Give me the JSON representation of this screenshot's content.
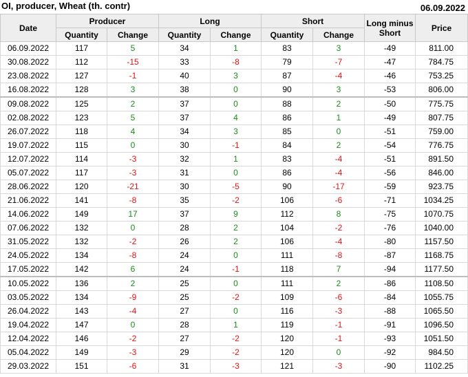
{
  "header": {
    "title": "OI, producer, Wheat (th. contr)",
    "date": "06.09.2022"
  },
  "columns": {
    "date": "Date",
    "producer": "Producer",
    "long": "Long",
    "short": "Short",
    "long_minus_short": "Long minus Short",
    "price": "Price",
    "quantity": "Quantity",
    "change": "Change"
  },
  "rows": [
    [
      "06.09.2022",
      "117",
      "5",
      "34",
      "1",
      "83",
      "3",
      "-49",
      "811.00"
    ],
    [
      "30.08.2022",
      "112",
      "-15",
      "33",
      "-8",
      "79",
      "-7",
      "-47",
      "784.75"
    ],
    [
      "23.08.2022",
      "127",
      "-1",
      "40",
      "3",
      "87",
      "-4",
      "-46",
      "753.25"
    ],
    [
      "16.08.2022",
      "128",
      "3",
      "38",
      "0",
      "90",
      "3",
      "-53",
      "806.00"
    ],
    [
      "09.08.2022",
      "125",
      "2",
      "37",
      "0",
      "88",
      "2",
      "-50",
      "775.75"
    ],
    [
      "02.08.2022",
      "123",
      "5",
      "37",
      "4",
      "86",
      "1",
      "-49",
      "807.75"
    ],
    [
      "26.07.2022",
      "118",
      "4",
      "34",
      "3",
      "85",
      "0",
      "-51",
      "759.00"
    ],
    [
      "19.07.2022",
      "115",
      "0",
      "30",
      "-1",
      "84",
      "2",
      "-54",
      "776.75"
    ],
    [
      "12.07.2022",
      "114",
      "-3",
      "32",
      "1",
      "83",
      "-4",
      "-51",
      "891.50"
    ],
    [
      "05.07.2022",
      "117",
      "-3",
      "31",
      "0",
      "86",
      "-4",
      "-56",
      "846.00"
    ],
    [
      "28.06.2022",
      "120",
      "-21",
      "30",
      "-5",
      "90",
      "-17",
      "-59",
      "923.75"
    ],
    [
      "21.06.2022",
      "141",
      "-8",
      "35",
      "-2",
      "106",
      "-6",
      "-71",
      "1034.25"
    ],
    [
      "14.06.2022",
      "149",
      "17",
      "37",
      "9",
      "112",
      "8",
      "-75",
      "1070.75"
    ],
    [
      "07.06.2022",
      "132",
      "0",
      "28",
      "2",
      "104",
      "-2",
      "-76",
      "1040.00"
    ],
    [
      "31.05.2022",
      "132",
      "-2",
      "26",
      "2",
      "106",
      "-4",
      "-80",
      "1157.50"
    ],
    [
      "24.05.2022",
      "134",
      "-8",
      "24",
      "0",
      "111",
      "-8",
      "-87",
      "1168.75"
    ],
    [
      "17.05.2022",
      "142",
      "6",
      "24",
      "-1",
      "118",
      "7",
      "-94",
      "1177.50"
    ],
    [
      "10.05.2022",
      "136",
      "2",
      "25",
      "0",
      "111",
      "2",
      "-86",
      "1108.50"
    ],
    [
      "03.05.2022",
      "134",
      "-9",
      "25",
      "-2",
      "109",
      "-6",
      "-84",
      "1055.75"
    ],
    [
      "26.04.2022",
      "143",
      "-4",
      "27",
      "0",
      "116",
      "-3",
      "-88",
      "1065.50"
    ],
    [
      "19.04.2022",
      "147",
      "0",
      "28",
      "1",
      "119",
      "-1",
      "-91",
      "1096.50"
    ],
    [
      "12.04.2022",
      "146",
      "-2",
      "27",
      "-2",
      "120",
      "-1",
      "-93",
      "1051.50"
    ],
    [
      "05.04.2022",
      "149",
      "-3",
      "29",
      "-2",
      "120",
      "0",
      "-92",
      "984.50"
    ],
    [
      "29.03.2022",
      "151",
      "-6",
      "31",
      "-3",
      "121",
      "-3",
      "-90",
      "1102.25"
    ]
  ],
  "section_breaks": [
    "09.08.2022",
    "10.05.2022"
  ],
  "colors": {
    "positive": "#1a8c1a",
    "negative": "#e01414",
    "header_bg": "#eeeeee"
  }
}
